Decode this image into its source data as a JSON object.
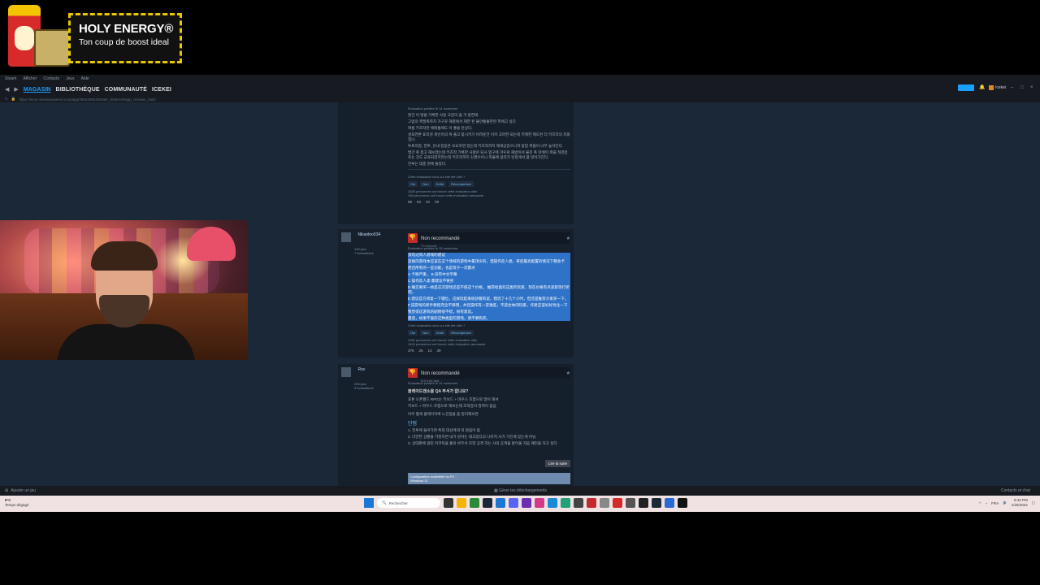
{
  "sponsor": {
    "brand": "HOLY ENERGY®",
    "tagline": "Ton coup de boost ideal"
  },
  "menubar": [
    "Steam",
    "Afficher",
    "Contacts",
    "Jeux",
    "Aide"
  ],
  "nav": {
    "tabs": [
      {
        "label": "MAGASIN",
        "active": true
      },
      {
        "label": "BIBLIOTHÈQUE",
        "active": false
      },
      {
        "label": "COMMUNAUTÉ",
        "active": false
      },
      {
        "label": "ICEKEI",
        "active": false
      }
    ],
    "username": "Icekei"
  },
  "url": "https://store.steampowered.com/app/3564280/Ultimate_Strikers/#app_reviews_hash",
  "reviews": [
    {
      "posted": "Évaluation publiée le 14 novembre",
      "paragraphs": [
        "발간 이 발을 기록한 사용 고감이 좀 가 갈한데.",
        "그럼의 핵필폭까지 가구로 해결에서 제한 된 불안통졸한란 학에고 싶다.",
        "여름 키조작만 애레통에도 이 좋을 안상다.",
        "성포연폰 표리성 개인이의 위 플고 맞시키기 어려운건 이카 고마한 되는데 키제한 제도된 더 키조작의 지휘입니.",
        "투토리얼, 힌트, 안내 등등은 보요하면 있는데 키조작까지 제세상길으니까 탐업 퍼플이 너무 높아진다.",
        "발간 폭 참고 해보겠는데 키조작 기록한 사항은 되사 업구에 겨우로 해방이서 불문 폭 막에이 퍼플 적관걷 로는 것도 교육되겠지만는데 키조작까지 신경쓰이니 피울에 몹러가 빈정게서 몸 넣어가진다.",
        "전투는 대충 원에 돌았다."
      ],
      "helpful_question": "Cette évaluation vous a-t-elle été utile ?",
      "buttons": [
        "Oui",
        "Non",
        "Drôle",
        "Récompenser"
      ],
      "counts": [
        "1626 personnes ont trouvé cette évaluation utile",
        "196 personnes ont trouvé cette évaluation amusante"
      ],
      "emojis": [
        "68",
        "63",
        "22",
        "29"
      ]
    },
    {
      "author": "Nikaidoo034",
      "author_meta": [
        "130 jeux",
        "7 évaluations"
      ],
      "verdict": "Non recommandé",
      "hours": "7 h en tout",
      "posted": "Évaluation publiée le 15 novembre",
      "highlighted": true,
      "paragraphs": [
        "没玩过同人游戏的建议",
        "這様的游戏本应该在这个领域的游戏中最顶尖的，但操作反人类，奇后最高配置的情况下都会卡",
        "而且所有的一些功能，也是等于一次都点",
        "A.卡顿严重。 B.没有中文字幕",
        "C.操作反人类 都建议不要买",
        "D.确实要买一枚是这次游戏还是不值这个价格。 推荐给喜欢这类的玩家，现在价格有点高就等打折吧。",
        "E.建议官方修复一下键位，这样玩起来很舒服的说，我玩了十几个小时，但还是推荐大家买一下。",
        "F.该游戏的新手教程完全不够用，并且操作有一定难度，不适合休闲玩家，作者应该好好优化一下",
        "我觉得这游戏的剧情很不错，很有意思。",
        "最后，如果不喜欢这种类型的游戏，请不要购买。"
      ],
      "helpful_question": "Cette évaluation vous a-t-elle été utile ?",
      "buttons": [
        "Oui",
        "Non",
        "Drôle",
        "Récompenser"
      ],
      "counts": [
        "1062 personnes ont trouvé cette évaluation utile",
        "1632 personnes ont trouvé cette évaluation amusante"
      ],
      "emojis": [
        "276",
        "25",
        "13",
        "39"
      ]
    },
    {
      "author": "Rov",
      "author_meta": [
        "234 jeux",
        "9 évaluations"
      ],
      "verdict": "Non recommandé",
      "hours": "6,6 h en tout",
      "posted": "Évaluation publiée le 14 novembre",
      "title": "블레이드앤소울 QA 부서가 없나요?",
      "paragraphs": [
        "포톤 오픈월드 RPG는 키보드 + 마우스 조합으로 많이 해서",
        "키보드 + 마우스 조합으로 해보는데 조작감이 엉켜이 없음",
        "아주 짧게 플레이하여 느낀점을 좀 정리해보면"
      ],
      "section": "단점",
      "list": [
        "1. 전투에 들어가면 특정 대상에게 락 걸림이 됨",
        "2. 다만한 상황을 가정하면 내가 원하는 대고있다고 나아지 사가 가진게 있는게 아님",
        "3. 상대편에 걸린 이코틱을 통의 바꾸서 모양 공격 하는 사의 공격을 받아올 처음 패턴을 하고 싶다"
      ],
      "read_more": "Lire la suite",
      "config_label": "Configuration matérielle du PC :",
      "config_os": "Windows 11"
    }
  ],
  "statusbar": {
    "add_game": "Ajouter un jeu",
    "downloads": "Gérer les téléchargements",
    "friends": "Contacts et chat"
  },
  "taskbar": {
    "weather_temp": "8°C",
    "weather_desc": "Temps dégagé",
    "search_placeholder": "Rechercher",
    "lang": "FRA",
    "time": "8:42 PM",
    "date": "1/26/2024"
  }
}
